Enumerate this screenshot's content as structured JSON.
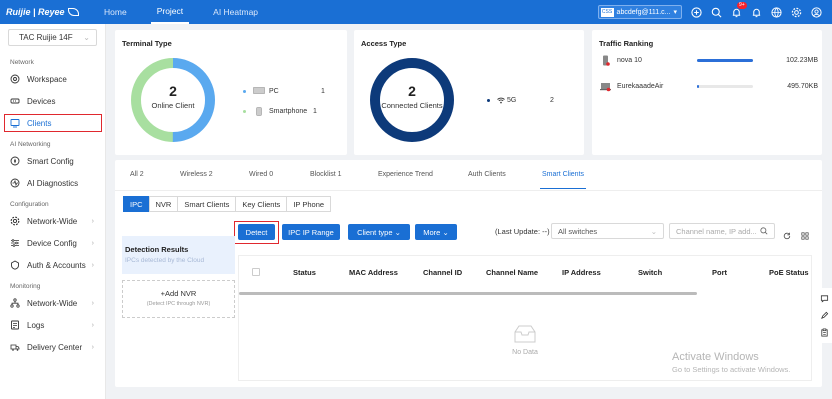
{
  "brand": {
    "logo_text": "Ruijie | Reyee"
  },
  "topnav": {
    "items": [
      "Home",
      "Project",
      "AI Heatmap"
    ],
    "active": "Project"
  },
  "account": {
    "chip": "CSS",
    "name": "abcdefg@111.c..."
  },
  "notifications": {
    "count": "9+"
  },
  "sidebar": {
    "site": "TAC Ruijie 14F",
    "sections": [
      {
        "title": "Network",
        "items": [
          {
            "label": "Workspace",
            "icon": "target-icon"
          },
          {
            "label": "Devices",
            "icon": "device-icon"
          },
          {
            "label": "Clients",
            "icon": "clients-icon",
            "active": true
          }
        ]
      },
      {
        "title": "AI Networking",
        "items": [
          {
            "label": "Smart Config",
            "icon": "spark-icon"
          },
          {
            "label": "AI Diagnostics",
            "icon": "diagnostics-icon"
          }
        ]
      },
      {
        "title": "Configuration",
        "items": [
          {
            "label": "Network-Wide",
            "icon": "gear-icon",
            "chevron": true
          },
          {
            "label": "Device Config",
            "icon": "sliders-icon",
            "chevron": true
          },
          {
            "label": "Auth & Accounts",
            "icon": "shield-icon",
            "chevron": true
          }
        ]
      },
      {
        "title": "Monitoring",
        "items": [
          {
            "label": "Network-Wide",
            "icon": "topology-icon",
            "chevron": true
          },
          {
            "label": "Logs",
            "icon": "log-icon",
            "chevron": true
          },
          {
            "label": "Delivery Center",
            "icon": "delivery-icon",
            "chevron": true
          }
        ]
      }
    ]
  },
  "terminal_type": {
    "title": "Terminal Type",
    "count": "2",
    "label": "Online Client",
    "legend": [
      {
        "name": "PC",
        "value": "1",
        "color": "#5aa9ef"
      },
      {
        "name": "Smartphone",
        "value": "1",
        "color": "#a8dfa0"
      }
    ]
  },
  "access_type": {
    "title": "Access Type",
    "count": "2",
    "label": "Connected Clients",
    "legend": [
      {
        "name": "5G",
        "value": "2",
        "color": "#0d3a7a"
      }
    ]
  },
  "traffic_ranking": {
    "title": "Traffic Ranking",
    "rows": [
      {
        "name": "nova 10",
        "value": "102.23MB",
        "fraction": 1.0
      },
      {
        "name": "EurekaaadeAir",
        "value": "495.70KB",
        "fraction": 0.02
      }
    ]
  },
  "client_tabs": [
    {
      "label": "All",
      "count": "2"
    },
    {
      "label": "Wireless",
      "count": "2"
    },
    {
      "label": "Wired",
      "count": "0"
    },
    {
      "label": "Blocklist",
      "count": "1"
    },
    {
      "label": "Experience Trend",
      "count": ""
    },
    {
      "label": "Auth Clients",
      "count": ""
    },
    {
      "label": "Smart Clients",
      "count": "",
      "active": true
    }
  ],
  "sub_tabs": [
    "IPC",
    "NVR",
    "Smart Clients",
    "Key Clients",
    "IP Phone"
  ],
  "toolbar": {
    "detect": "Detect",
    "ipc_ip_range": "IPC IP Range",
    "client_type": "Client type",
    "more": "More",
    "last_update": "(Last Update: --)",
    "switch_select": "All switches",
    "search_placeholder": "Channel name, IP add..."
  },
  "left_panel": {
    "detection_title": "Detection Results",
    "detection_sub": "IPCs detected by the Cloud",
    "add_nvr": "+Add NVR",
    "add_nvr_sub": "(Detect IPC through NVR)"
  },
  "table": {
    "columns": [
      "Status",
      "MAC Address",
      "Channel ID",
      "Channel Name",
      "IP Address",
      "Switch",
      "Port",
      "PoE Status"
    ],
    "empty_text": "No Data"
  },
  "watermark": {
    "line1": "Activate Windows",
    "line2": "Go to Settings to activate Windows."
  }
}
